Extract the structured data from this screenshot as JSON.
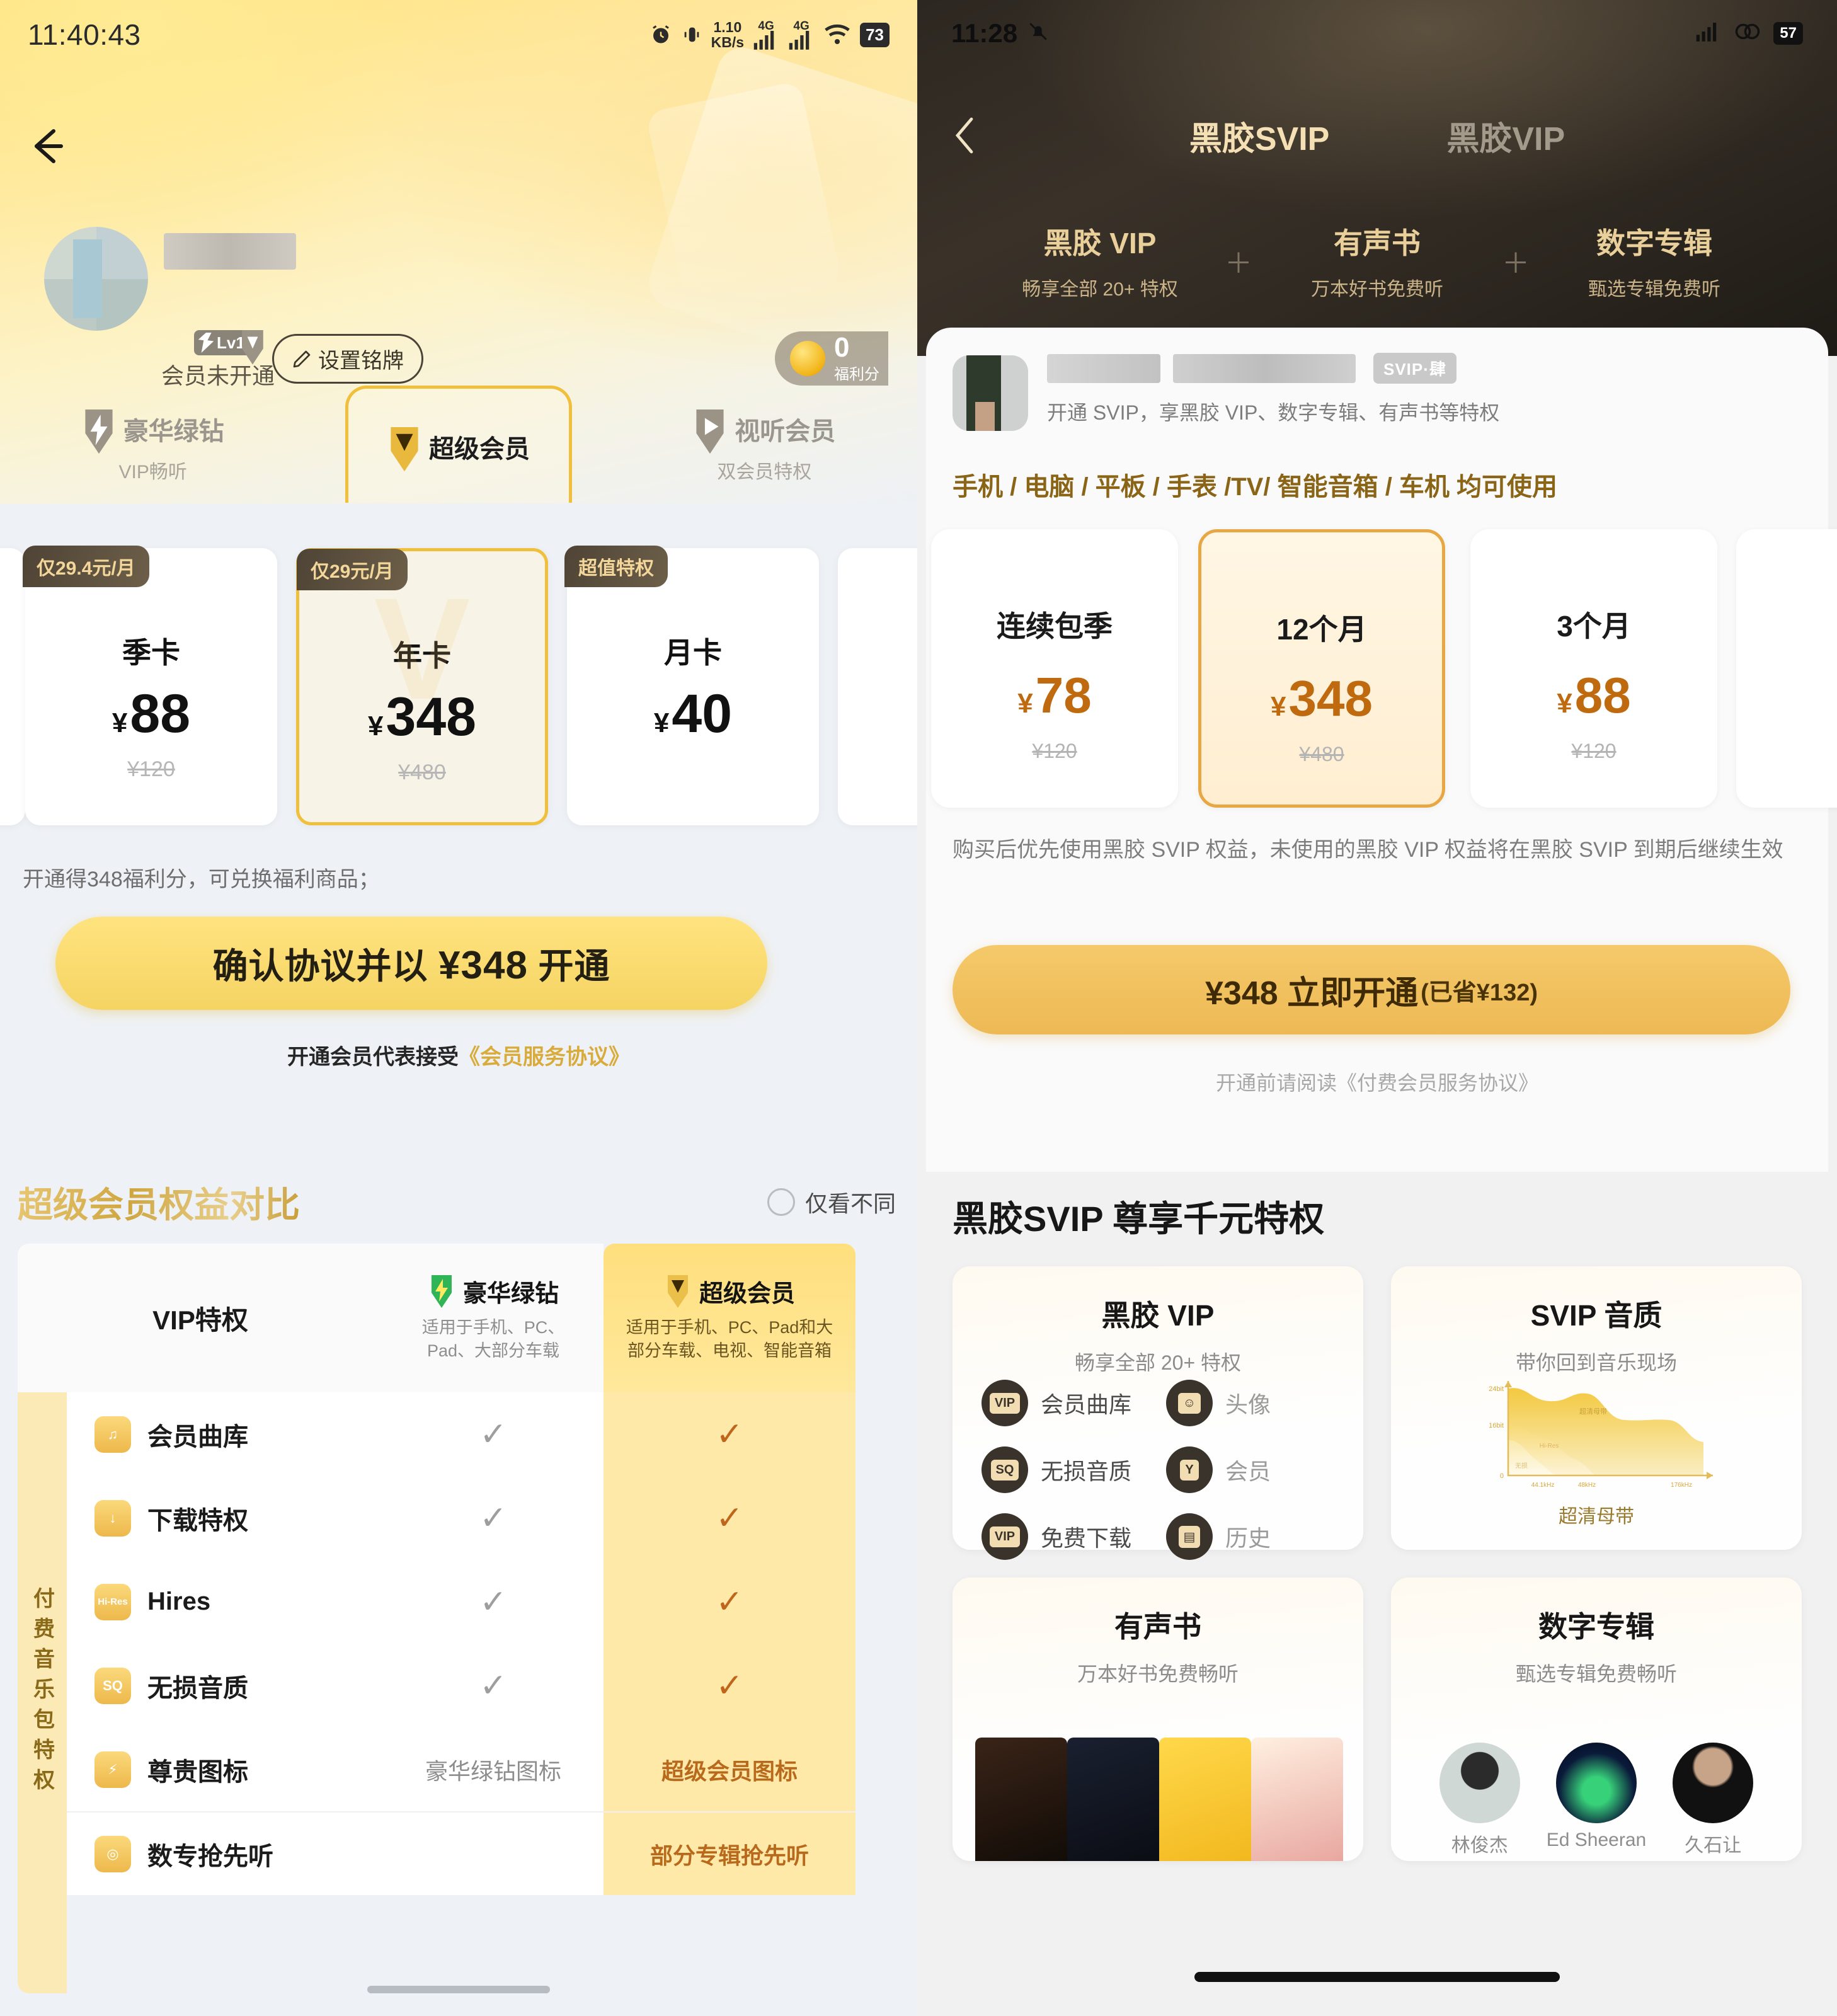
{
  "left": {
    "status": {
      "time": "11:40:43",
      "net_speed": "1.10",
      "net_unit": "KB/s",
      "sim1": "4G",
      "sim2": "4G",
      "battery": "73"
    },
    "profile": {
      "plate_button": "设置铭牌",
      "level_tag": "Lv1",
      "subtitle": "会员未开通",
      "score_value": "0",
      "score_label": "福利分"
    },
    "tabs": [
      {
        "name": "豪华绿钻",
        "sub": "VIP畅听",
        "icon": "diamond-icon"
      },
      {
        "name": "超级会员",
        "sub": "",
        "icon": "crown-v-icon"
      },
      {
        "name": "视听会员",
        "sub": "双会员特权",
        "icon": "play-icon"
      }
    ],
    "cards": [
      {
        "tag": "仅29.4元/月",
        "title": "季卡",
        "yen": "¥",
        "price": "88",
        "orig": "¥120",
        "selected": false
      },
      {
        "tag": "仅29元/月",
        "title": "年卡",
        "yen": "¥",
        "price": "348",
        "orig": "¥480",
        "selected": true
      },
      {
        "tag": "超值特权",
        "title": "月卡",
        "yen": "¥",
        "price": "40",
        "orig": "",
        "selected": false
      }
    ],
    "bonus_note": "开通得348福利分，可兑换福利商品；",
    "cta": {
      "prefix": "确认协议并以 ",
      "amount": "¥348",
      "suffix": " 开通"
    },
    "agreement": {
      "text": "开通会员代表接受",
      "link": "《会员服务协议》"
    },
    "compare": {
      "title": "超级会员权益对比",
      "only_diff": "仅看不同",
      "col1_label": "VIP特权",
      "col2": {
        "brand": "豪华绿钻",
        "desc": "适用于手机、PC、Pad、大部分车载"
      },
      "col3": {
        "brand": "超级会员",
        "desc": "适用于手机、PC、Pad和大部分车载、电视、智能音箱"
      },
      "side_label": "付费音乐包特权",
      "rows": [
        {
          "icon": "music-note-icon",
          "icon_text": "♫",
          "feature": "会员曲库",
          "a": "✓",
          "b": "✓",
          "a_type": "tick",
          "b_type": "tick"
        },
        {
          "icon": "download-icon",
          "icon_text": "↓",
          "feature": "下载特权",
          "a": "✓",
          "b": "✓",
          "a_type": "tick",
          "b_type": "tick"
        },
        {
          "icon": "hires-icon",
          "icon_text": "Hi-Res",
          "feature": "Hires",
          "a": "✓",
          "b": "✓",
          "a_type": "tick",
          "b_type": "tick"
        },
        {
          "icon": "sq-icon",
          "icon_text": "SQ",
          "feature": "无损音质",
          "a": "✓",
          "b": "✓",
          "a_type": "tick",
          "b_type": "tick"
        },
        {
          "icon": "badge-icon",
          "icon_text": "⚡",
          "feature": "尊贵图标",
          "a": "豪华绿钻图标",
          "b": "超级会员图标",
          "a_type": "text",
          "b_type": "text"
        },
        {
          "icon": "album-icon",
          "icon_text": "◎",
          "feature": "数专抢先听",
          "a": "",
          "b": "部分专辑抢先听",
          "a_type": "text",
          "b_type": "text"
        }
      ]
    }
  },
  "right": {
    "status": {
      "time": "11:28",
      "battery": "57"
    },
    "nav": {
      "tab_active": "黑胶SVIP",
      "tab_inactive": "黑胶VIP"
    },
    "benefits": [
      {
        "title": "黑胶 VIP",
        "sub": "畅享全部 20+ 特权"
      },
      {
        "title": "有声书",
        "sub": "万本好书免费听"
      },
      {
        "title": "数字专辑",
        "sub": "甄选专辑免费听"
      }
    ],
    "plus_symbol": "＋",
    "user": {
      "badge": "SVIP·肆",
      "subtitle": "开通 SVIP，享黑胶 VIP、数字专辑、有声书等特权"
    },
    "devices": "手机 / 电脑 / 平板 / 手表 /TV/ 智能音箱 / 车机 均可使用",
    "cards": [
      {
        "title": "连续包季",
        "yen": "¥",
        "price": "78",
        "orig": "¥120",
        "selected": false
      },
      {
        "title": "12个月",
        "yen": "¥",
        "price": "348",
        "orig": "¥480",
        "selected": true
      },
      {
        "title": "3个月",
        "yen": "¥",
        "price": "88",
        "orig": "¥120",
        "selected": false
      },
      {
        "title": "",
        "yen": "¥",
        "price": "",
        "orig": "",
        "selected": false
      }
    ],
    "note": "购买后优先使用黑胶 SVIP 权益，未使用的黑胶 VIP 权益将在黑胶 SVIP 到期后继续生效",
    "cta": {
      "main": "¥348 立即开通",
      "sub": "(已省¥132)"
    },
    "agreement": "开通前请阅读《付费会员服务协议》",
    "privileges_title": "黑胶SVIP 尊享千元特权",
    "privilege_cards": [
      {
        "title": "黑胶 VIP",
        "sub": "畅享全部 20+ 特权",
        "features": [
          {
            "chip": "VIP",
            "label": "会员曲库",
            "fade": false
          },
          {
            "chip": "☺",
            "label": "头像",
            "fade": true
          },
          {
            "chip": "SQ",
            "label": "无损音质",
            "fade": false
          },
          {
            "chip": "Y",
            "label": "会员",
            "fade": true
          },
          {
            "chip": "VIP",
            "label": "免费下载",
            "fade": false
          },
          {
            "chip": "▤",
            "label": "历史",
            "fade": true
          }
        ]
      },
      {
        "title": "SVIP 音质",
        "sub": "带你回到音乐现场",
        "caption": "超清母带"
      },
      {
        "title": "有声书",
        "sub": "万本好书免费畅听"
      },
      {
        "title": "数字专辑",
        "sub": "甄选专辑免费畅听",
        "artists": [
          "林俊杰",
          "Ed Sheeran",
          "久石让"
        ]
      }
    ]
  },
  "chart_data": {
    "type": "area",
    "title": "超清母带",
    "xlabel": "",
    "ylabel": "",
    "ylim": [
      0,
      24
    ],
    "ytick_labels": [
      "0",
      "16bit",
      "24bit"
    ],
    "ytick_values": [
      0,
      16,
      24
    ],
    "xtick_labels": [
      "44.1kHz",
      "48kHz",
      "176kHz"
    ],
    "xtick_values": [
      44.1,
      48,
      176
    ],
    "series": [
      {
        "name": "超清母带",
        "values": [
          24,
          23,
          21,
          20,
          20,
          16,
          15,
          15,
          9,
          8,
          0
        ]
      },
      {
        "name": "Hi-Res",
        "values": [
          16,
          15,
          13,
          11,
          7,
          4,
          0,
          0,
          0,
          0,
          0
        ]
      },
      {
        "name": "无损",
        "values": [
          9,
          8,
          6,
          3,
          0,
          0,
          0,
          0,
          0,
          0,
          0
        ]
      }
    ],
    "legend_position": "inline",
    "grid": false
  }
}
